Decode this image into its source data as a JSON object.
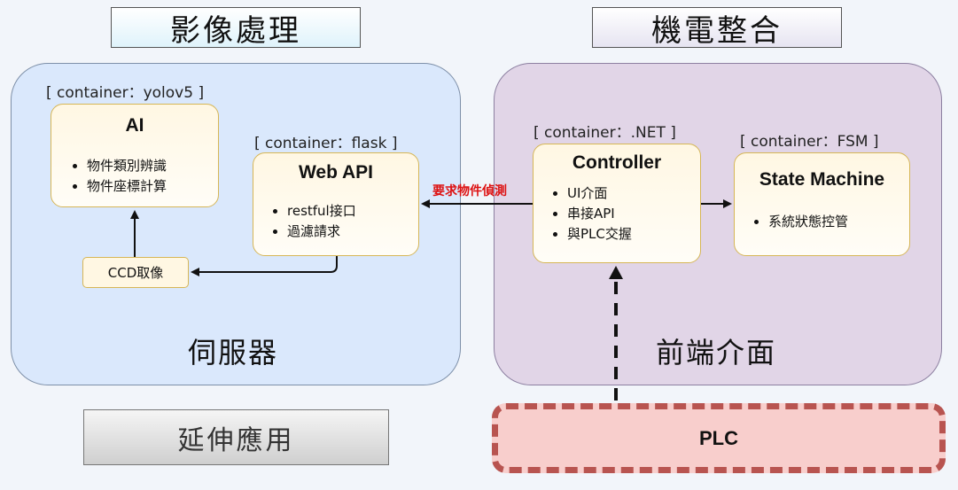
{
  "titles": {
    "left": "影像處理",
    "right": "機電整合"
  },
  "zones": {
    "server": "伺服器",
    "frontend": "前端介面"
  },
  "ai": {
    "container": "[ container：yolov5 ]",
    "title": "AI",
    "items": [
      "物件類別辨識",
      "物件座標計算"
    ]
  },
  "webapi": {
    "container": "[ container：flask ]",
    "title": "Web API",
    "items": [
      "restful接口",
      "過濾請求"
    ]
  },
  "controller": {
    "container": "[ container：.NET ]",
    "title": "Controller",
    "items": [
      "UI介面",
      "串接API",
      "與PLC交握"
    ]
  },
  "state": {
    "container": "[ container：FSM ]",
    "title": "State Machine",
    "items": [
      "系統狀態控管"
    ]
  },
  "ccd": "CCD取像",
  "request_label": "要求物件偵測",
  "extension": "延伸應用",
  "plc": "PLC",
  "colors": {
    "server_zone": "#dae8fc",
    "frontend_zone": "#e1d5e7",
    "card_fill": "#fff2cc",
    "card_border": "#d6b656",
    "plc_fill": "#f8cecc",
    "plc_border": "#b85450",
    "request_text": "#dd1111"
  }
}
